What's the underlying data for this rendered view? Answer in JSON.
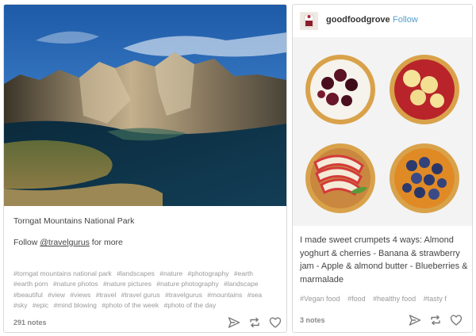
{
  "left_post": {
    "title": "Torngat Mountains National Park",
    "follow_prefix": "Follow ",
    "follow_handle": "@travelgurus",
    "follow_suffix": " for more",
    "tags": [
      "#torngat mountains national park",
      "#landscapes",
      "#nature",
      "#photography",
      "#earth",
      "#earth porn",
      "#nature photos",
      "#nature pictures",
      "#nature photography",
      "#landscape",
      "#beautiful",
      "#view",
      "#views",
      "#travel",
      "#travel gurus",
      "#travelgurus",
      "#mountains",
      "#sea",
      "#sky",
      "#epic",
      "#mind blowing",
      "#photo of the week",
      "#photo of the day"
    ],
    "notes": "291 notes"
  },
  "right_post": {
    "blog_name": "goodfoodgrove",
    "follow_label": "Follow",
    "caption": "I made sweet crumpets 4 ways: Almond yoghurt & cherries - Banana & strawberry jam - Apple & almond butter - Blueberries & marmalade",
    "tags": [
      "#Vegan food",
      "#food",
      "#healthy food",
      "#tasty f"
    ],
    "notes": "3 notes"
  },
  "icons": {
    "share": "paper-plane-icon",
    "reblog": "reblog-icon",
    "like": "heart-icon"
  },
  "colors": {
    "follow_link": "#529ecc",
    "tag_text": "#9a9a9a",
    "border": "#d9d9d9"
  }
}
